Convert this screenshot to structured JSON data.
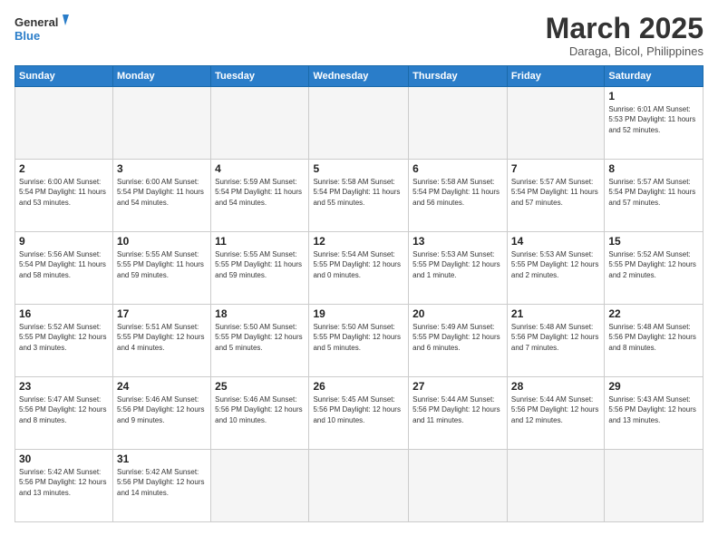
{
  "header": {
    "logo_general": "General",
    "logo_blue": "Blue",
    "month_title": "March 2025",
    "subtitle": "Daraga, Bicol, Philippines"
  },
  "weekdays": [
    "Sunday",
    "Monday",
    "Tuesday",
    "Wednesday",
    "Thursday",
    "Friday",
    "Saturday"
  ],
  "weeks": [
    [
      {
        "day": "",
        "info": ""
      },
      {
        "day": "",
        "info": ""
      },
      {
        "day": "",
        "info": ""
      },
      {
        "day": "",
        "info": ""
      },
      {
        "day": "",
        "info": ""
      },
      {
        "day": "",
        "info": ""
      },
      {
        "day": "1",
        "info": "Sunrise: 6:01 AM\nSunset: 5:53 PM\nDaylight: 11 hours\nand 52 minutes."
      }
    ],
    [
      {
        "day": "2",
        "info": "Sunrise: 6:00 AM\nSunset: 5:54 PM\nDaylight: 11 hours\nand 53 minutes."
      },
      {
        "day": "3",
        "info": "Sunrise: 6:00 AM\nSunset: 5:54 PM\nDaylight: 11 hours\nand 54 minutes."
      },
      {
        "day": "4",
        "info": "Sunrise: 5:59 AM\nSunset: 5:54 PM\nDaylight: 11 hours\nand 54 minutes."
      },
      {
        "day": "5",
        "info": "Sunrise: 5:58 AM\nSunset: 5:54 PM\nDaylight: 11 hours\nand 55 minutes."
      },
      {
        "day": "6",
        "info": "Sunrise: 5:58 AM\nSunset: 5:54 PM\nDaylight: 11 hours\nand 56 minutes."
      },
      {
        "day": "7",
        "info": "Sunrise: 5:57 AM\nSunset: 5:54 PM\nDaylight: 11 hours\nand 57 minutes."
      },
      {
        "day": "8",
        "info": "Sunrise: 5:57 AM\nSunset: 5:54 PM\nDaylight: 11 hours\nand 57 minutes."
      }
    ],
    [
      {
        "day": "9",
        "info": "Sunrise: 5:56 AM\nSunset: 5:54 PM\nDaylight: 11 hours\nand 58 minutes."
      },
      {
        "day": "10",
        "info": "Sunrise: 5:55 AM\nSunset: 5:55 PM\nDaylight: 11 hours\nand 59 minutes."
      },
      {
        "day": "11",
        "info": "Sunrise: 5:55 AM\nSunset: 5:55 PM\nDaylight: 11 hours\nand 59 minutes."
      },
      {
        "day": "12",
        "info": "Sunrise: 5:54 AM\nSunset: 5:55 PM\nDaylight: 12 hours\nand 0 minutes."
      },
      {
        "day": "13",
        "info": "Sunrise: 5:53 AM\nSunset: 5:55 PM\nDaylight: 12 hours\nand 1 minute."
      },
      {
        "day": "14",
        "info": "Sunrise: 5:53 AM\nSunset: 5:55 PM\nDaylight: 12 hours\nand 2 minutes."
      },
      {
        "day": "15",
        "info": "Sunrise: 5:52 AM\nSunset: 5:55 PM\nDaylight: 12 hours\nand 2 minutes."
      }
    ],
    [
      {
        "day": "16",
        "info": "Sunrise: 5:52 AM\nSunset: 5:55 PM\nDaylight: 12 hours\nand 3 minutes."
      },
      {
        "day": "17",
        "info": "Sunrise: 5:51 AM\nSunset: 5:55 PM\nDaylight: 12 hours\nand 4 minutes."
      },
      {
        "day": "18",
        "info": "Sunrise: 5:50 AM\nSunset: 5:55 PM\nDaylight: 12 hours\nand 5 minutes."
      },
      {
        "day": "19",
        "info": "Sunrise: 5:50 AM\nSunset: 5:55 PM\nDaylight: 12 hours\nand 5 minutes."
      },
      {
        "day": "20",
        "info": "Sunrise: 5:49 AM\nSunset: 5:55 PM\nDaylight: 12 hours\nand 6 minutes."
      },
      {
        "day": "21",
        "info": "Sunrise: 5:48 AM\nSunset: 5:56 PM\nDaylight: 12 hours\nand 7 minutes."
      },
      {
        "day": "22",
        "info": "Sunrise: 5:48 AM\nSunset: 5:56 PM\nDaylight: 12 hours\nand 8 minutes."
      }
    ],
    [
      {
        "day": "23",
        "info": "Sunrise: 5:47 AM\nSunset: 5:56 PM\nDaylight: 12 hours\nand 8 minutes."
      },
      {
        "day": "24",
        "info": "Sunrise: 5:46 AM\nSunset: 5:56 PM\nDaylight: 12 hours\nand 9 minutes."
      },
      {
        "day": "25",
        "info": "Sunrise: 5:46 AM\nSunset: 5:56 PM\nDaylight: 12 hours\nand 10 minutes."
      },
      {
        "day": "26",
        "info": "Sunrise: 5:45 AM\nSunset: 5:56 PM\nDaylight: 12 hours\nand 10 minutes."
      },
      {
        "day": "27",
        "info": "Sunrise: 5:44 AM\nSunset: 5:56 PM\nDaylight: 12 hours\nand 11 minutes."
      },
      {
        "day": "28",
        "info": "Sunrise: 5:44 AM\nSunset: 5:56 PM\nDaylight: 12 hours\nand 12 minutes."
      },
      {
        "day": "29",
        "info": "Sunrise: 5:43 AM\nSunset: 5:56 PM\nDaylight: 12 hours\nand 13 minutes."
      }
    ],
    [
      {
        "day": "30",
        "info": "Sunrise: 5:42 AM\nSunset: 5:56 PM\nDaylight: 12 hours\nand 13 minutes."
      },
      {
        "day": "31",
        "info": "Sunrise: 5:42 AM\nSunset: 5:56 PM\nDaylight: 12 hours\nand 14 minutes."
      },
      {
        "day": "",
        "info": ""
      },
      {
        "day": "",
        "info": ""
      },
      {
        "day": "",
        "info": ""
      },
      {
        "day": "",
        "info": ""
      },
      {
        "day": "",
        "info": ""
      }
    ]
  ]
}
